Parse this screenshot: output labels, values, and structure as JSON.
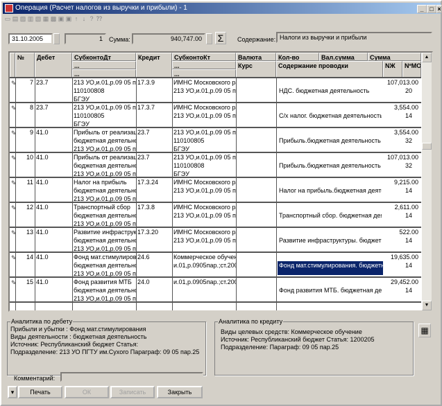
{
  "window": {
    "title": "Операция (Расчет налогов из выручки и прибыли) - 1"
  },
  "toolbar": {
    "icons": [
      "new-icon",
      "copy-icon",
      "edit-icon",
      "delete-icon",
      "mark-icon",
      "folder-icon",
      "structure-icon",
      "add-line-icon",
      "remove-line-icon",
      "up-arrow-icon",
      "down-arrow-icon",
      "help-icon",
      "whats-this-icon"
    ]
  },
  "header": {
    "date": "31.10.2005",
    "number": "1",
    "sum_label": "Сумма:",
    "sum": "940,747.00",
    "content_label": "Содержание:",
    "content": "Налоги из выручки и прибыли"
  },
  "columns": {
    "marker": "",
    "num": "№",
    "debit": "Дебет",
    "subdt": "СубконтоДт",
    "credit": "Кредит",
    "subkt": "СубконтоКт",
    "currency": "Валюта",
    "qty": "Кол-во",
    "cursum": "Вал.сумма",
    "sum": "Сумма",
    "rate": "Курс",
    "desc": "Содержание проводки",
    "nj": "NЖ",
    "nmo": "NºМО",
    "dots": "..."
  },
  "rows": [
    {
      "n": "7",
      "debit": "23.7",
      "subdt": [
        "213 УО,и.01,р.09 05 пар.",
        "110100808",
        "БГЭУ"
      ],
      "credit": "17.3.9",
      "subkt": [
        "ИМНС Московского ра",
        "213 УО,и.01,р.09 05 пар.",
        ""
      ],
      "sum": "107,013.00",
      "desc": "НДС. бюджетная деятельность",
      "nmo": "20"
    },
    {
      "n": "8",
      "debit": "23.7",
      "subdt": [
        "213 УО,и.01,р.09 05 пар.",
        "110100805",
        "БГЭУ"
      ],
      "credit": "17.3.7",
      "subkt": [
        "ИМНС Московского ра",
        "213 УО,и.01,р.09 05 пар.",
        ""
      ],
      "sum": "3,554.00",
      "desc": "С/х налог.  бюджетная деятельность",
      "nmo": "14"
    },
    {
      "n": "9",
      "debit": "41.0",
      "subdt": [
        "Прибыль от реализаці",
        "бюджетная деятельно",
        "213 УО,и.01,р.09 05 пар."
      ],
      "credit": "23.7",
      "subkt": [
        "213 УО,и.01,р.09 05 пар.",
        "110100805",
        "БГЭУ"
      ],
      "sum": "3,554.00",
      "desc": "Прибыль.бюджетная деятельность",
      "nmo": "32"
    },
    {
      "n": "10",
      "debit": "41.0",
      "subdt": [
        "Прибыль от реализаці",
        "бюджетная деятельно",
        "213 УО,и.01,р.09 05 пар."
      ],
      "credit": "23.7",
      "subkt": [
        "213 УО,и.01,р.09 05 пар.",
        "110100808",
        "БГЭУ"
      ],
      "sum": "107,013.00",
      "desc": "Прибыль.бюджетная деятельность",
      "nmo": "32"
    },
    {
      "n": "11",
      "debit": "41.0",
      "subdt": [
        "Налог на прибыль",
        "бюджетная деятельно",
        "213 УО,и.01,р.09 05 пар."
      ],
      "credit": "17.3.24",
      "subkt": [
        "ИМНС Московского ра",
        "213 УО,и.01,р.09 05 пар.",
        ""
      ],
      "sum": "9,215.00",
      "desc": "Налог на прибыль.бюджетная деятель",
      "nmo": "14"
    },
    {
      "n": "12",
      "debit": "41.0",
      "subdt": [
        "Транспортный сбор",
        "бюджетная деятельно",
        "213 УО,и.01,р.09 05 пар."
      ],
      "credit": "17.3.8",
      "subkt": [
        "ИМНС Московского ра",
        "213 УО,и.01,р.09 05 пар.",
        ""
      ],
      "sum": "2,611.00",
      "desc": "Транспортный сбор. бюджетная деяте",
      "nmo": "14"
    },
    {
      "n": "13",
      "debit": "41.0",
      "subdt": [
        "Развитие инфраструк",
        "бюджетная деятельно",
        "213 УО,и.01,р.09 05 пар."
      ],
      "credit": "17.3.20",
      "subkt": [
        "ИМНС Московского ра",
        "213 УО,и.01,р.09 05 пар.",
        ""
      ],
      "sum": "522.00",
      "desc": "Развитие инфраструктуры. бюджетн",
      "nmo": "14"
    },
    {
      "n": "14",
      "debit": "41.0",
      "subdt": [
        "Фонд мат.стимулирові",
        "бюджетная деятельно",
        "213 УО,и.01,р.09 05 пар."
      ],
      "credit": "24.6",
      "subkt": [
        "Коммерческое обучен",
        "и.01,р.0905пар.;ст.20020",
        ""
      ],
      "sum": "19,635.00",
      "desc": "Фонд мат.стимулирования. бюджетная",
      "nmo": "14",
      "selected": true
    },
    {
      "n": "15",
      "debit": "41.0",
      "subdt": [
        "Фонд развития МТБ",
        "бюджетная деятельно",
        "213 УО,и.01,р.09 05 пар."
      ],
      "credit": "24.0",
      "subkt": [
        "и.01,р.0905пар.;ст.20020",
        "",
        ""
      ],
      "sum": "29,452.00",
      "desc": "Фонд развития МТБ. бюджетная деяте",
      "nmo": "14"
    }
  ],
  "debit_analytics": {
    "caption": "Аналитика по дебету",
    "lines": [
      "Прибыли и убытки :  Фонд мат.стимулирования",
      "Виды деятельности :  бюджетная деятельность",
      "Источник:  Республиканский бюджет    Статья:",
      "Подразделение:  213 УО ПГТУ им.Сухого    Параграф:  09 05 пар.25"
    ]
  },
  "credit_analytics": {
    "caption": "Аналитика по кредиту",
    "lines": [
      "Виды целевых средств:  Коммерческое обучение",
      "Источник:  Республиканский бюджет    Статья:  1200205",
      "Подразделение:      Параграф:  09 05 пар.25"
    ]
  },
  "footer": {
    "comment_label": "Комментарий:",
    "comment": "",
    "print": "Печать",
    "ok": "ОК",
    "save": "Записать",
    "close": "Закрыть"
  }
}
